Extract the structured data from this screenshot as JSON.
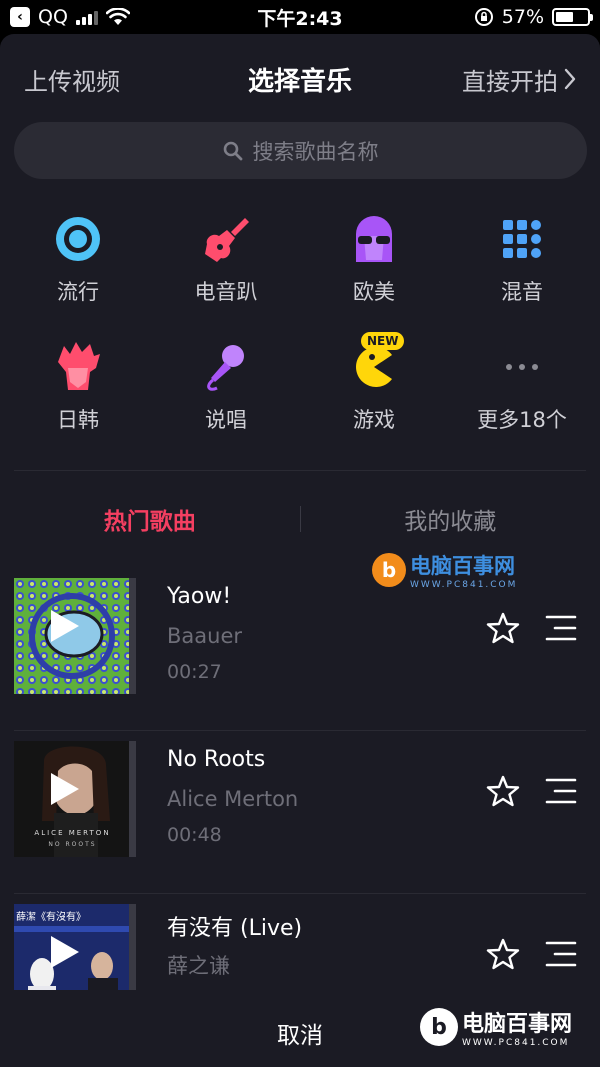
{
  "status_bar": {
    "app": "QQ",
    "time": "下午2:43",
    "battery": "57%",
    "battery_level": 0.57
  },
  "header": {
    "upload": "上传视频",
    "title": "选择音乐",
    "shoot": "直接开拍",
    "shoot_icon": "chevron-right-icon"
  },
  "search": {
    "placeholder": "搜索歌曲名称",
    "icon": "search-icon"
  },
  "categories": [
    {
      "label": "流行",
      "icon": "vinyl-icon"
    },
    {
      "label": "电音趴",
      "icon": "electric-guitar-icon"
    },
    {
      "label": "欧美",
      "icon": "sunglasses-person-icon"
    },
    {
      "label": "混音",
      "icon": "grid-dots-icon"
    },
    {
      "label": "日韩",
      "icon": "spiky-hair-icon"
    },
    {
      "label": "说唱",
      "icon": "microphone-icon"
    },
    {
      "label": "游戏",
      "icon": "pacman-icon",
      "badge": "NEW"
    },
    {
      "label": "更多18个",
      "icon": "more-dots-icon"
    }
  ],
  "tabs": {
    "hot": "热门歌曲",
    "favorites": "我的收藏"
  },
  "watermark": {
    "title": "电脑百事网",
    "url": "WWW.PC841.COM"
  },
  "songs": [
    {
      "title": "Yaow!",
      "artist": "Baauer",
      "duration": "00:27",
      "cover_text": ""
    },
    {
      "title": "No Roots",
      "artist": "Alice Merton",
      "duration": "00:48",
      "cover_text": "ALICE MERTON",
      "cover_sub": "NO ROOTS"
    },
    {
      "title": "有没有 (Live)",
      "artist": "薛之谦",
      "duration": "",
      "cover_text": "薛潔《有沒有》"
    }
  ],
  "footer": {
    "cancel": "取消"
  },
  "colors": {
    "accent": "#f43f61",
    "background": "#1b1b24",
    "watermark_blue": "#3e8fe0"
  }
}
